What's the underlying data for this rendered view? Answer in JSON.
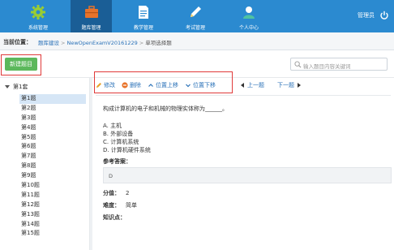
{
  "topnav": {
    "items": [
      {
        "label": "系统管理",
        "icon": "gear-icon"
      },
      {
        "label": "题库管理",
        "icon": "briefcase-icon"
      },
      {
        "label": "教学管理",
        "icon": "document-icon"
      },
      {
        "label": "考试管理",
        "icon": "pencil-icon"
      },
      {
        "label": "个人中心",
        "icon": "user-icon"
      }
    ],
    "active_index": 1,
    "user_label": "管理员",
    "colors": {
      "bar": "#2b8ad0",
      "active": "#1a5e96"
    }
  },
  "breadcrumb": {
    "current_label": "当前位置：",
    "items": [
      "题库建设",
      "NewOpenExamV20161229",
      "单项选择题"
    ]
  },
  "toolbar": {
    "new_button_label": "新建题目",
    "search_placeholder": "输入题目内容关键词"
  },
  "tree": {
    "root_label": "第1套",
    "items": [
      "第1题",
      "第2题",
      "第3题",
      "第4题",
      "第5题",
      "第6题",
      "第7题",
      "第8题",
      "第9题",
      "第10题",
      "第11题",
      "第12题",
      "第13题",
      "第14题",
      "第15题"
    ],
    "selected_index": 0
  },
  "actions": {
    "edit_label": "修改",
    "delete_label": "删除",
    "move_up_label": "位置上移",
    "move_down_label": "位置下移",
    "prev_label": "上一题",
    "next_label": "下一题"
  },
  "question": {
    "stem": "构成计算机的电子和机械的物理实体称为______。",
    "options": [
      "A.  主机",
      "B.  外部设备",
      "C.  计算机系统",
      "D.  计算机硬件系统"
    ],
    "answer_label": "参考答案：",
    "answer": "D",
    "score_label": "分值：",
    "score": "2",
    "difficulty_label": "难度：",
    "difficulty": "简单",
    "knowledge_label": "知识点："
  }
}
